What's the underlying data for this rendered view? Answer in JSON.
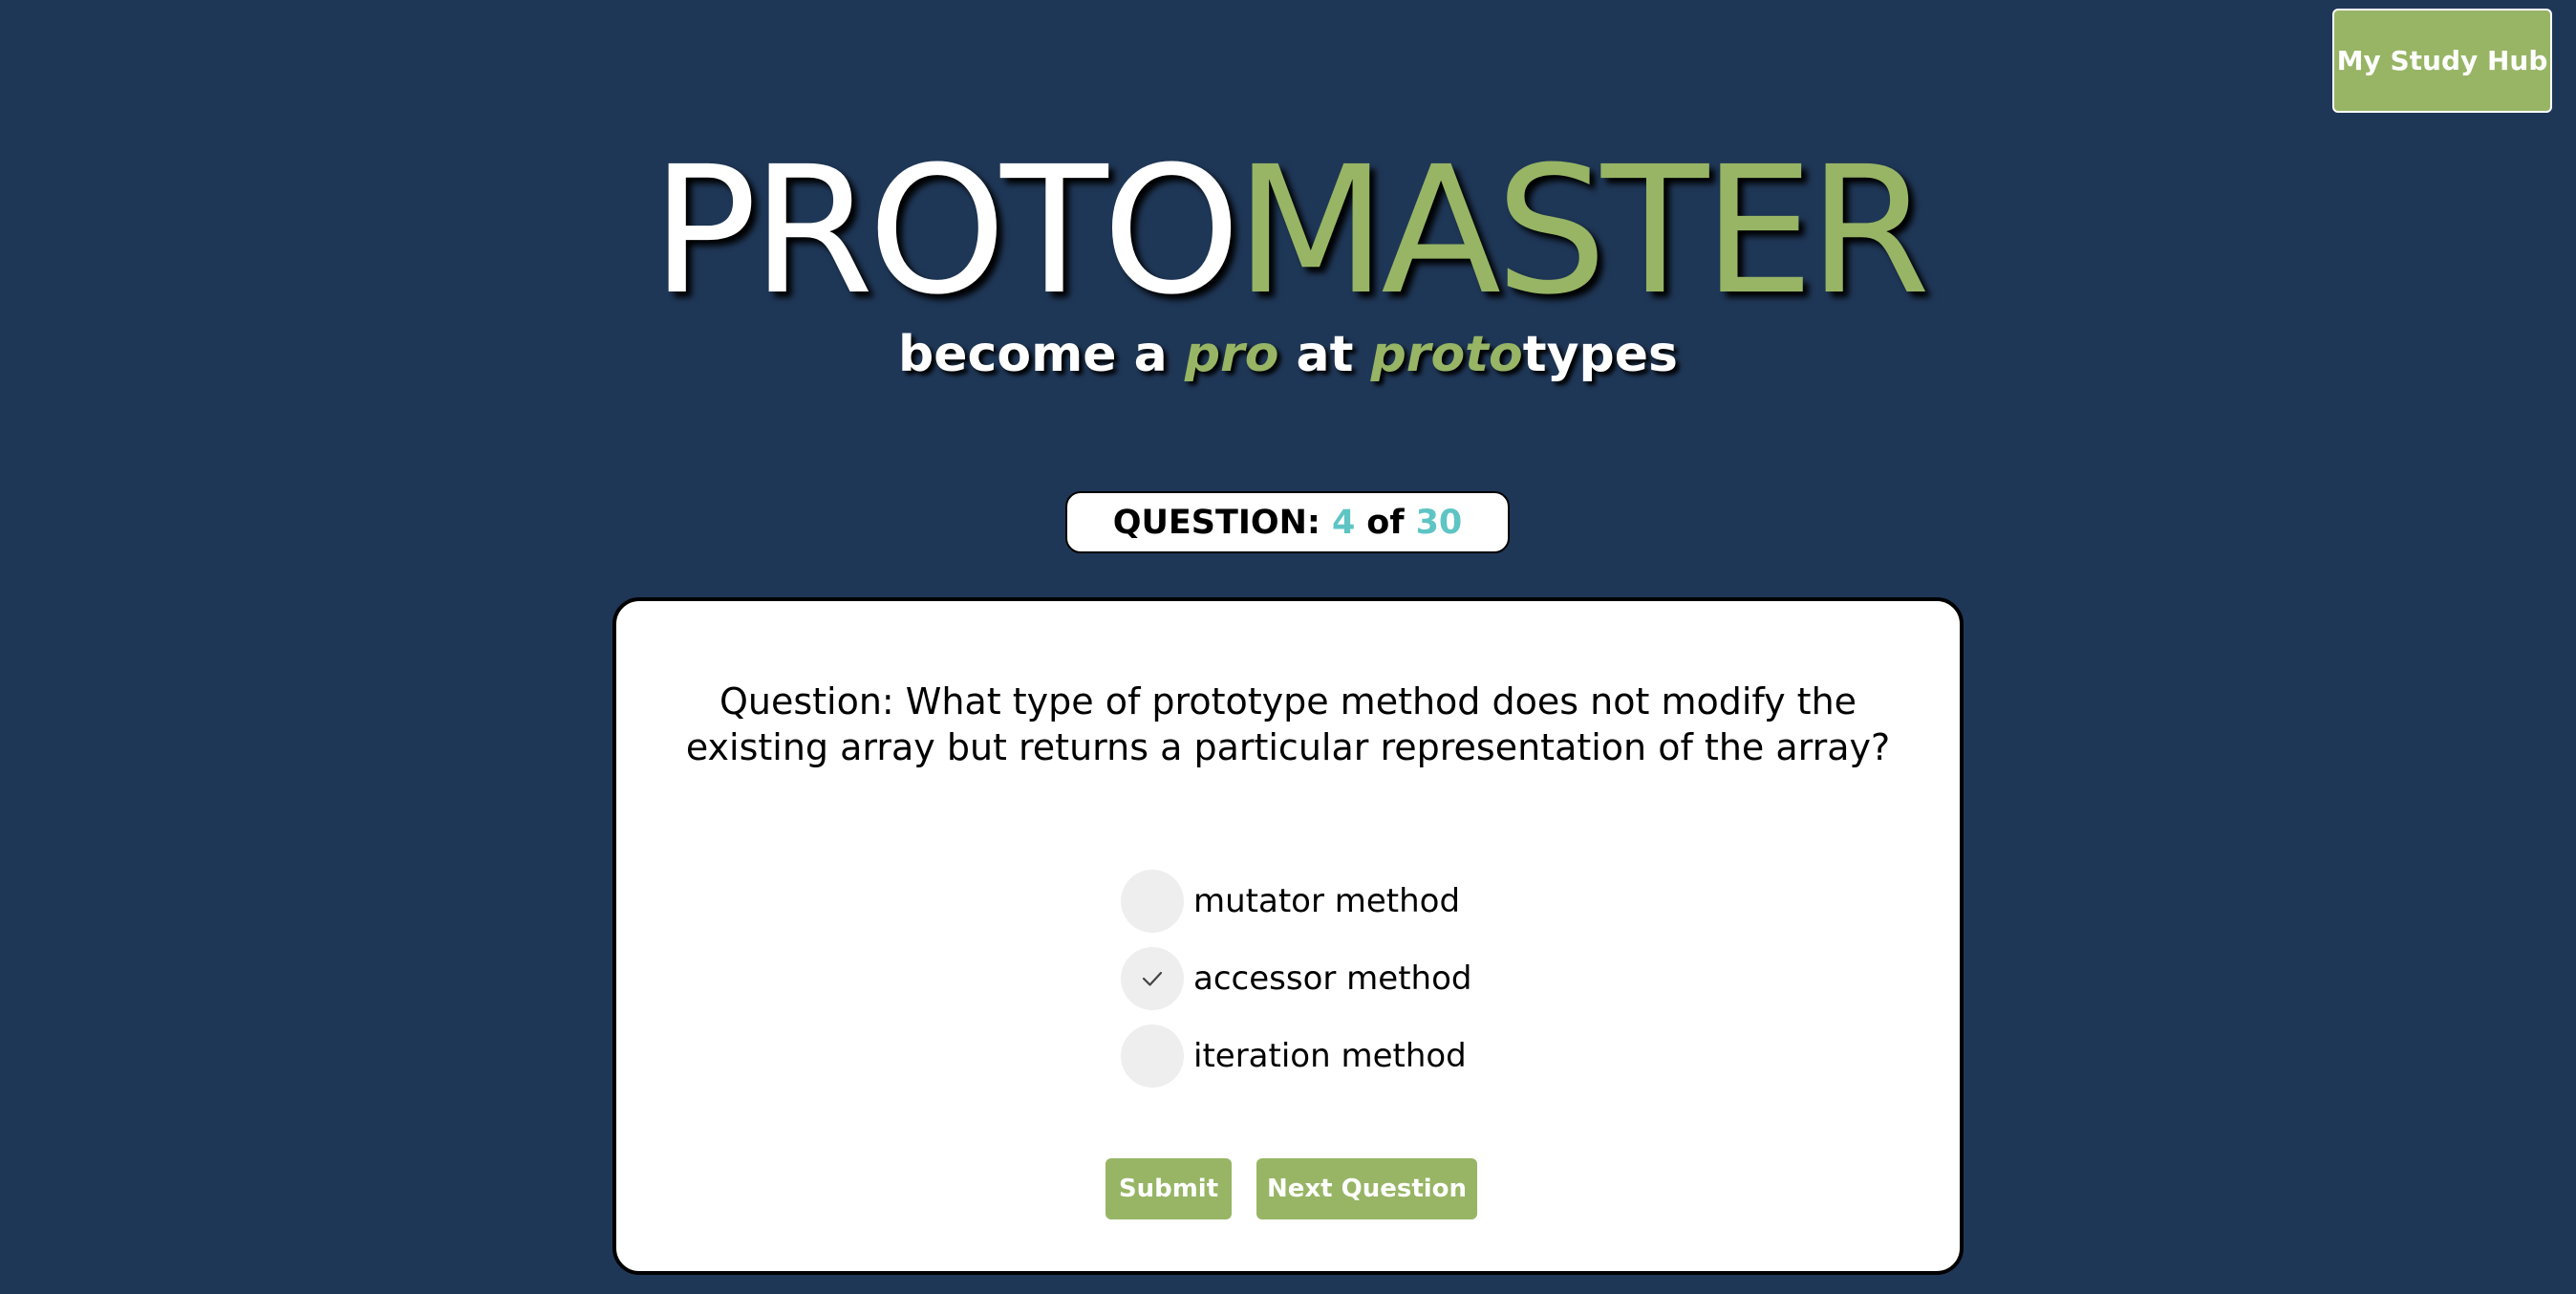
{
  "header": {
    "study_hub_label": "My Study Hub"
  },
  "logo": {
    "part1": "PROTO",
    "part2": "MASTER"
  },
  "tagline": {
    "t1": "become a ",
    "t2": "pro",
    "t3": " at ",
    "t4": "proto",
    "t5": "types"
  },
  "progress": {
    "label": "QUESTION:",
    "current": "4",
    "of_word": "of",
    "total": "30"
  },
  "question": {
    "text": "Question: What type of prototype method does not modify the existing array but returns a particular representation of the array?",
    "options": [
      {
        "label": "mutator method",
        "selected": false
      },
      {
        "label": "accessor method",
        "selected": true
      },
      {
        "label": "iteration method",
        "selected": false
      }
    ],
    "check_icon": "checkmark-icon"
  },
  "actions": {
    "submit_label": "Submit",
    "next_label": "Next Question"
  },
  "colors": {
    "background": "#1f3757",
    "accent_green": "#97b565",
    "counter_teal": "#5ec4c4"
  }
}
